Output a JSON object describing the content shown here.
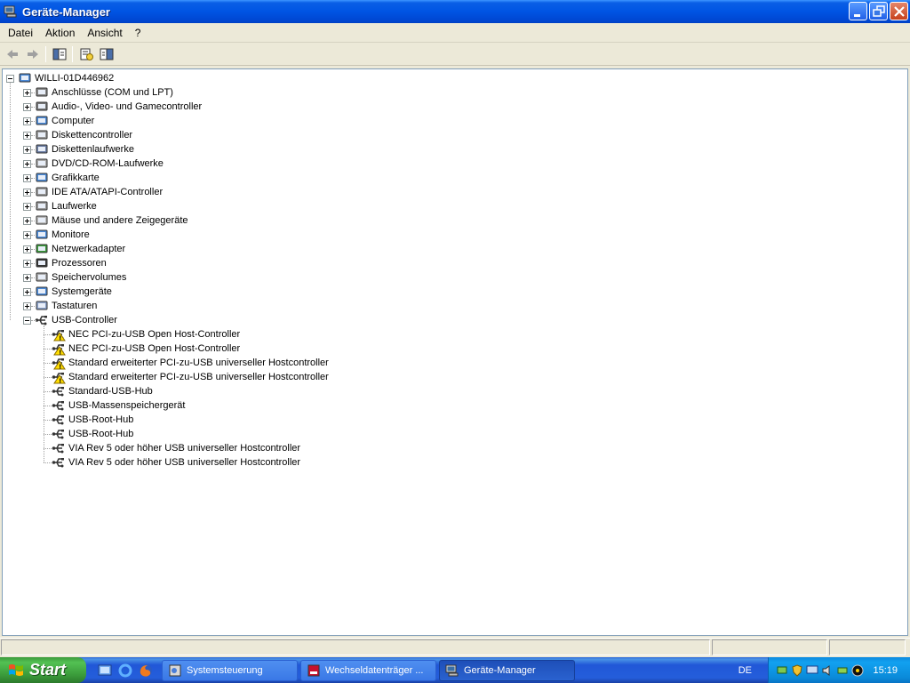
{
  "window": {
    "title": "Geräte-Manager"
  },
  "menu": [
    "Datei",
    "Aktion",
    "Ansicht",
    "?"
  ],
  "tree": {
    "root": "WILLI-01D446962",
    "categories": [
      "Anschlüsse (COM und LPT)",
      "Audio-, Video- und Gamecontroller",
      "Computer",
      "Diskettencontroller",
      "Diskettenlaufwerke",
      "DVD/CD-ROM-Laufwerke",
      "Grafikkarte",
      "IDE ATA/ATAPI-Controller",
      "Laufwerke",
      "Mäuse und andere Zeigegeräte",
      "Monitore",
      "Netzwerkadapter",
      "Prozessoren",
      "Speichervolumes",
      "Systemgeräte",
      "Tastaturen",
      "USB-Controller"
    ],
    "usb_devices": [
      {
        "label": "NEC PCI-zu-USB Open Host-Controller",
        "warning": true
      },
      {
        "label": "NEC PCI-zu-USB Open Host-Controller",
        "warning": true
      },
      {
        "label": "Standard erweiterter PCI-zu-USB universeller Hostcontroller",
        "warning": true
      },
      {
        "label": "Standard erweiterter PCI-zu-USB universeller Hostcontroller",
        "warning": true
      },
      {
        "label": "Standard-USB-Hub",
        "warning": false
      },
      {
        "label": "USB-Massenspeichergerät",
        "warning": false
      },
      {
        "label": "USB-Root-Hub",
        "warning": false
      },
      {
        "label": "USB-Root-Hub",
        "warning": false
      },
      {
        "label": "VIA Rev 5 oder höher USB universeller Hostcontroller",
        "warning": false
      },
      {
        "label": "VIA Rev 5 oder höher USB universeller Hostcontroller",
        "warning": false
      }
    ]
  },
  "taskbar": {
    "start": "Start",
    "tasks": [
      "Systemsteuerung",
      "Wechseldatenträger ...",
      "Geräte-Manager"
    ],
    "language": "DE",
    "clock": "15:19"
  }
}
